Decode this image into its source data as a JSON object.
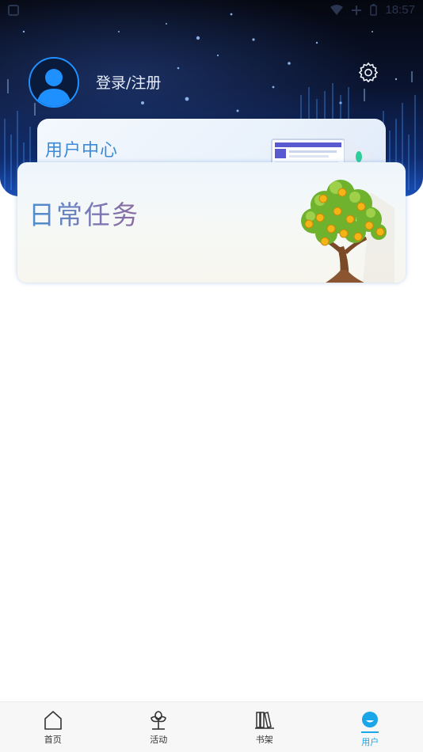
{
  "status_bar": {
    "time": "18:57"
  },
  "header": {
    "login_label": "登录/注册"
  },
  "cards": {
    "user_center": {
      "title": "用户中心"
    },
    "daily_tasks": {
      "title": "日常任务"
    }
  },
  "bottom_nav": {
    "items": [
      {
        "label": "首页",
        "icon": "home-icon",
        "active": false
      },
      {
        "label": "活动",
        "icon": "sprout-icon",
        "active": false
      },
      {
        "label": "书架",
        "icon": "bookshelf-icon",
        "active": false
      },
      {
        "label": "用户",
        "icon": "user-icon",
        "active": true
      }
    ]
  },
  "colors": {
    "accent": "#1aa6e8",
    "avatar_ring": "#1e90ff",
    "banner_dark": "#05070f",
    "banner_blue": "#1b4fb8"
  }
}
